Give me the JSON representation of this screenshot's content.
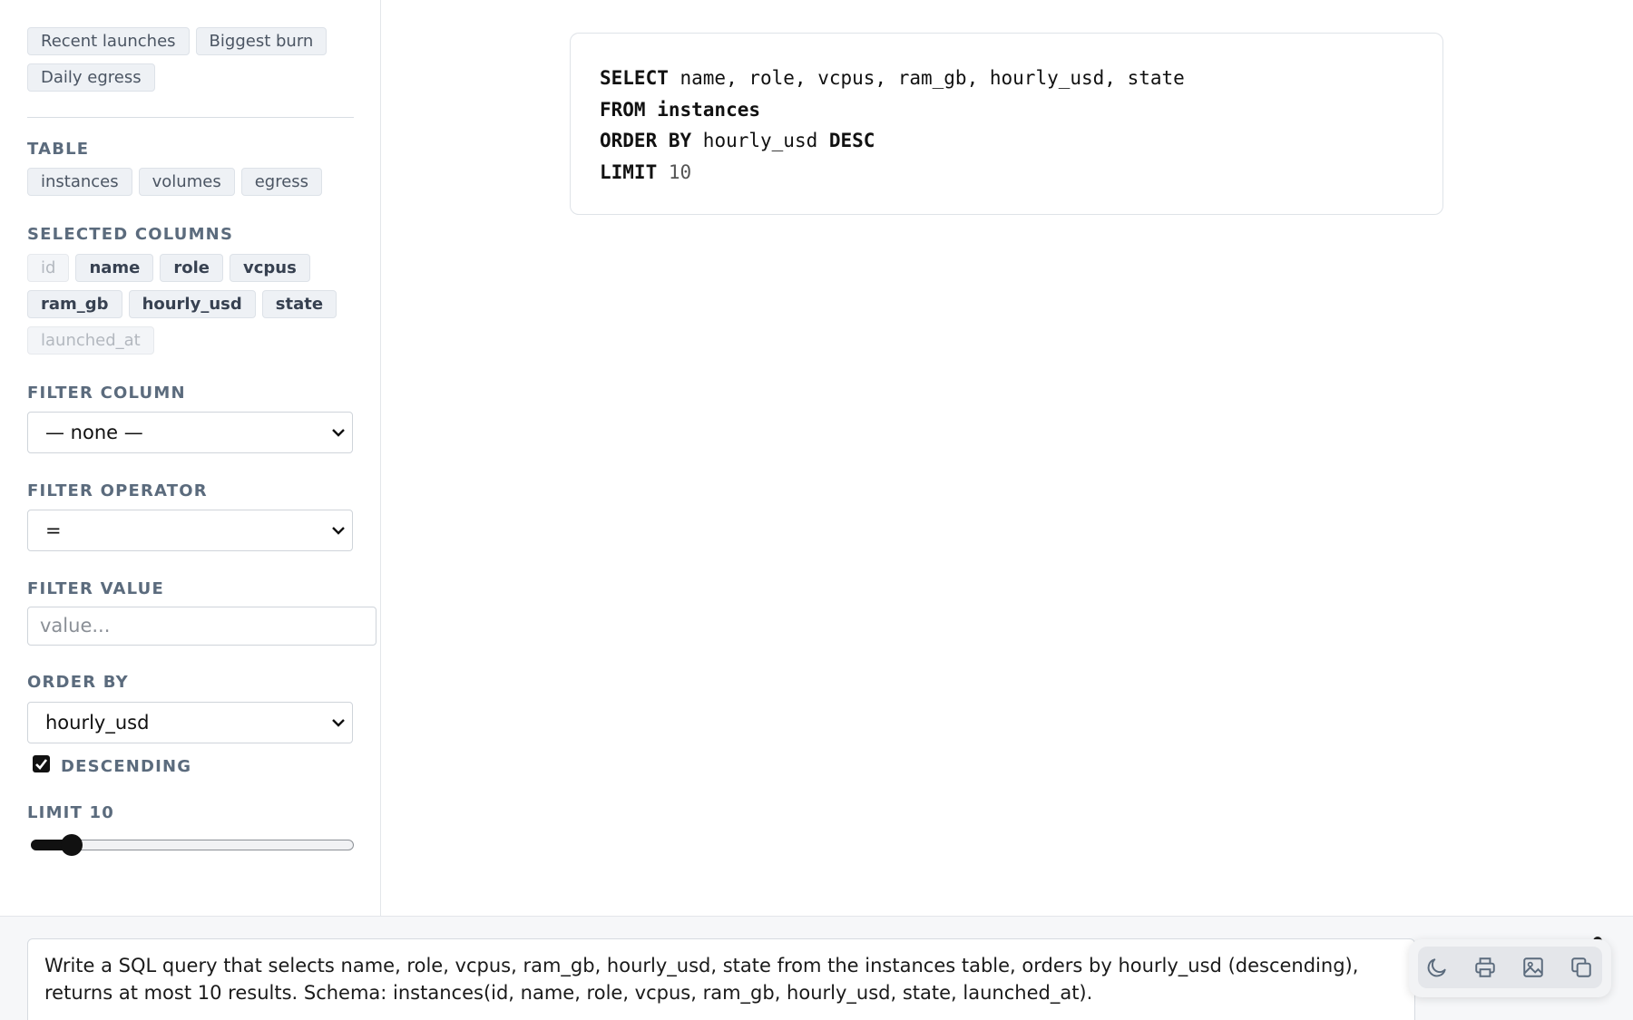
{
  "presets": [
    "Recent launches",
    "Biggest burn",
    "Daily egress"
  ],
  "table_section": {
    "label": "TABLE",
    "options": [
      "instances",
      "volumes",
      "egress"
    ]
  },
  "columns_section": {
    "label": "SELECTED COLUMNS",
    "columns": [
      {
        "name": "id",
        "selected": false
      },
      {
        "name": "name",
        "selected": true
      },
      {
        "name": "role",
        "selected": true
      },
      {
        "name": "vcpus",
        "selected": true
      },
      {
        "name": "ram_gb",
        "selected": true
      },
      {
        "name": "hourly_usd",
        "selected": true
      },
      {
        "name": "state",
        "selected": true
      },
      {
        "name": "launched_at",
        "selected": false
      }
    ]
  },
  "filter_column": {
    "label": "FILTER COLUMN",
    "value": "— none —"
  },
  "filter_operator": {
    "label": "FILTER OPERATOR",
    "value": "="
  },
  "filter_value": {
    "label": "FILTER VALUE",
    "placeholder": "value..."
  },
  "order_by": {
    "label": "ORDER BY",
    "value": "hourly_usd"
  },
  "descending": {
    "label": "DESCENDING",
    "checked": true
  },
  "limit": {
    "label": "LIMIT 10",
    "value": 10,
    "fraction": 0.1
  },
  "sql": {
    "line1_kw": "SELECT",
    "line1_rest": " name, role, vcpus, ram_gb, hourly_usd, state",
    "line2_kw": "FROM instances",
    "line3_kw1": "ORDER BY",
    "line3_mid": " hourly_usd ",
    "line3_kw2": "DESC",
    "line4_kw": "LIMIT",
    "line4_num": " 10"
  },
  "prompt_text": "Write a SQL query that selects name, role, vcpus, ram_gb, hourly_usd, state from the instances table, orders by hourly_usd (descending), returns at most 10 results. Schema: instances(id, name, role, vcpus, ram_gb, hourly_usd, state, launched_at).",
  "toolbar": {
    "icons": [
      "moon-icon",
      "printer-icon",
      "image-icon",
      "copy-icon"
    ]
  }
}
